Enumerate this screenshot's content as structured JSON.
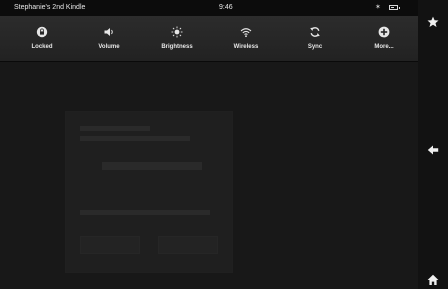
{
  "status_bar": {
    "device_name": "Stephanie's 2nd Kindle",
    "time": "9:46",
    "bluetooth_glyph": "✶",
    "battery_level_fraction": 0.6
  },
  "quick_settings": [
    {
      "label": "Locked",
      "icon": "lock-rotation-icon"
    },
    {
      "label": "Volume",
      "icon": "volume-icon"
    },
    {
      "label": "Brightness",
      "icon": "brightness-icon"
    },
    {
      "label": "Wireless",
      "icon": "wireless-icon"
    },
    {
      "label": "Sync",
      "icon": "sync-icon"
    },
    {
      "label": "More...",
      "icon": "more-icon"
    }
  ],
  "side_bar": {
    "buttons": [
      "star-icon",
      "back-icon",
      "home-icon"
    ]
  },
  "colors": {
    "background": "#1a1a1a",
    "panel": "#262626",
    "text": "#e6e6e6"
  }
}
